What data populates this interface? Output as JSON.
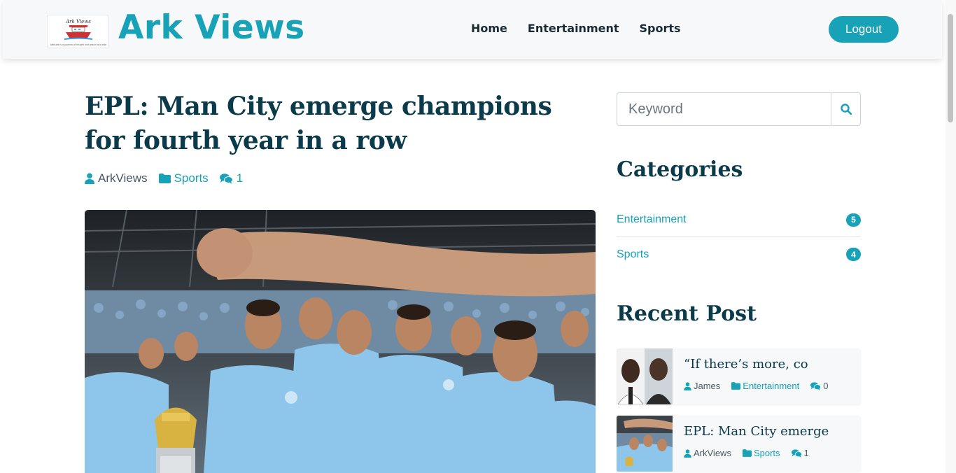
{
  "header": {
    "brand": "Ark Views",
    "logo_text": "Ark Views",
    "logo_tagline": "Attitude is a journey of insight and grace to a wise",
    "nav": [
      "Home",
      "Entertainment",
      "Sports"
    ],
    "logout_label": "Logout"
  },
  "article": {
    "title": "EPL: Man City emerge champions for fourth year in a row",
    "author": "ArkViews",
    "category": "Sports",
    "comments": "1"
  },
  "sidebar": {
    "search_placeholder": "Keyword",
    "categories_heading": "Categories",
    "categories": [
      {
        "name": "Entertainment",
        "count": "5"
      },
      {
        "name": "Sports",
        "count": "4"
      }
    ],
    "recent_heading": "Recent Post",
    "recent_posts": [
      {
        "title": "“If there’s more, co",
        "author": "James",
        "category": "Entertainment",
        "comments": "0"
      },
      {
        "title": "EPL: Man City emerge",
        "author": "ArkViews",
        "category": "Sports",
        "comments": "1"
      }
    ]
  },
  "colors": {
    "accent": "#17a2b8",
    "heading": "#0b3a4a",
    "navbar_bg": "#f6f8fa",
    "city_blue": "#8ec5ea"
  },
  "icons": [
    "user-icon",
    "folder-icon",
    "comments-icon",
    "search-icon"
  ]
}
